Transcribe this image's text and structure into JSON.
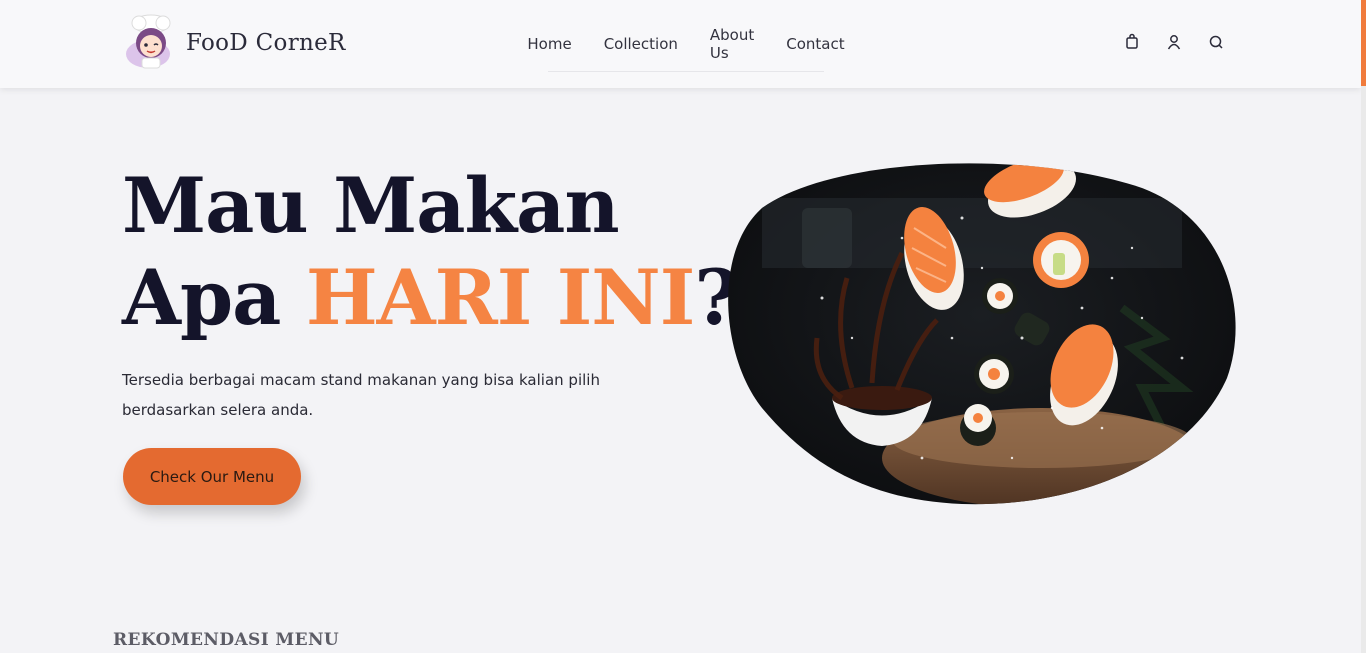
{
  "brand": {
    "name": "FooD CorneR",
    "accent_color": "#f58443",
    "button_color": "#e46a30"
  },
  "nav": {
    "items": [
      {
        "label": "Home"
      },
      {
        "label": "Collection"
      },
      {
        "label": "About Us"
      },
      {
        "label": "Contact"
      }
    ]
  },
  "header_icons": [
    "shopping-bag-icon",
    "user-icon",
    "search-icon"
  ],
  "hero": {
    "title_line1": "Mau Makan",
    "title_line2_prefix": "Apa ",
    "title_highlight": "HARI INI",
    "title_suffix": "?",
    "description": "Tersedia berbagai macam stand makanan yang bisa kalian pilih berdasarkan selera anda.",
    "cta_label": "Check Our Menu",
    "image": "sushi-photo"
  },
  "section": {
    "title": "REKOMENDASI MENU"
  }
}
